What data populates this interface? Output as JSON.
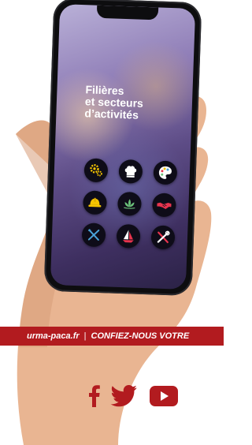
{
  "screen": {
    "title_lines": [
      "Filières",
      "et secteurs",
      "d’activités"
    ]
  },
  "icons": [
    {
      "name": "gears-icon",
      "color": "#f5c400"
    },
    {
      "name": "chef-hat-icon",
      "color": "#ffffff"
    },
    {
      "name": "paint-palette-icon",
      "color": "#ffffff"
    },
    {
      "name": "hard-hat-icon",
      "color": "#f5c400"
    },
    {
      "name": "lotus-icon",
      "color": "#6bc07a"
    },
    {
      "name": "handshake-icon",
      "color": "#e8344e"
    },
    {
      "name": "fork-knife-icon",
      "color": "#4aa3d8"
    },
    {
      "name": "sailboat-icon",
      "color": "#e8344e"
    },
    {
      "name": "tools-icon",
      "color": "#e8344e"
    }
  ],
  "banner": {
    "site": "urma-paca.fr",
    "separator": "|",
    "tagline": "CONFIEZ-NOUS VOTRE"
  },
  "social": {
    "color": "#b21b1f",
    "items": [
      "facebook-icon",
      "twitter-icon",
      "youtube-icon"
    ]
  }
}
